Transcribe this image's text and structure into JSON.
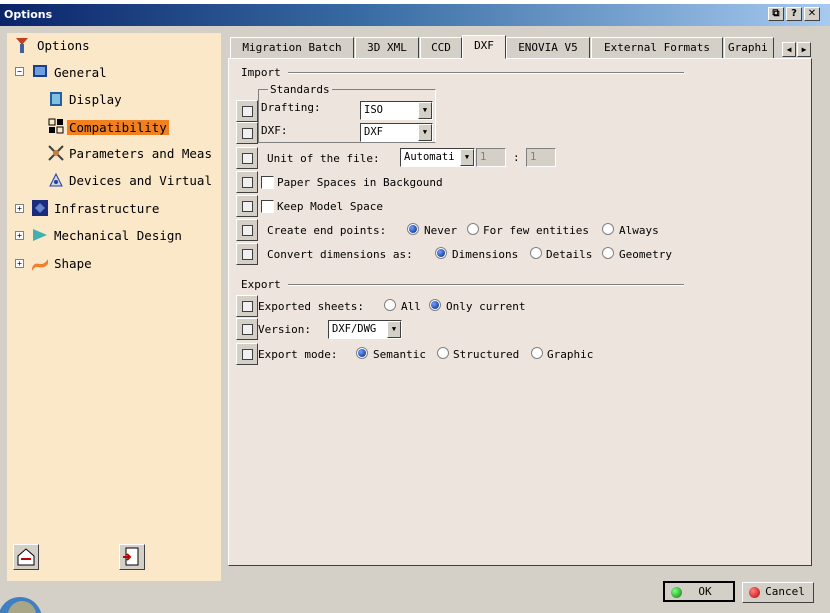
{
  "window": {
    "title": "Options",
    "buttons": {
      "restore": "⧉",
      "help": "?",
      "close": "✕"
    }
  },
  "tree": {
    "root": "Options",
    "items": [
      {
        "label": "General",
        "icon": "general-icon"
      },
      {
        "label": "Display",
        "icon": "display-icon"
      },
      {
        "label": "Compatibility",
        "icon": "compatibility-icon"
      },
      {
        "label": "Parameters and Meas",
        "icon": "parameters-icon"
      },
      {
        "label": "Devices and Virtual",
        "icon": "devices-icon"
      },
      {
        "label": "Infrastructure",
        "icon": "infrastructure-icon"
      },
      {
        "label": "Mechanical Design",
        "icon": "mechanical-design-icon"
      },
      {
        "label": "Shape",
        "icon": "shape-icon"
      }
    ]
  },
  "tabs": [
    "Migration Batch",
    "3D XML",
    "CCD",
    "DXF",
    "ENOVIA V5",
    "External Formats",
    "Graphi"
  ],
  "active_tab": "DXF",
  "import": {
    "title": "Import",
    "standards_title": "Standards",
    "drafting_label": "Drafting:",
    "drafting_value": "ISO",
    "dxf_label": "DXF:",
    "dxf_value": "DXF",
    "unit_label": "Unit of the file:",
    "unit_value": "Automati",
    "unit_field1": "1",
    "unit_sep": ":",
    "unit_field2": "1",
    "paper_spaces_label": "Paper Spaces in Backgound",
    "keep_model_label": "Keep Model Space",
    "end_points_label": "Create end points:",
    "end_points_options": [
      "Never",
      "For few entities",
      "Always"
    ],
    "convert_label": "Convert dimensions as:",
    "convert_options": [
      "Dimensions",
      "Details",
      "Geometry"
    ]
  },
  "export": {
    "title": "Export",
    "sheets_label": "Exported sheets:",
    "sheets_options": [
      "All",
      "Only current"
    ],
    "version_label": "Version:",
    "version_value": "DXF/DWG",
    "mode_label": "Export mode:",
    "mode_options": [
      "Semantic",
      "Structured",
      "Graphic"
    ]
  },
  "footer": {
    "ok": "OK",
    "cancel": "Cancel"
  },
  "colors": {
    "selection": "#f08020",
    "tree_bg": "#fbe8c8",
    "panel_bg": "#ede5dd",
    "title_blue": "#0a246a"
  }
}
